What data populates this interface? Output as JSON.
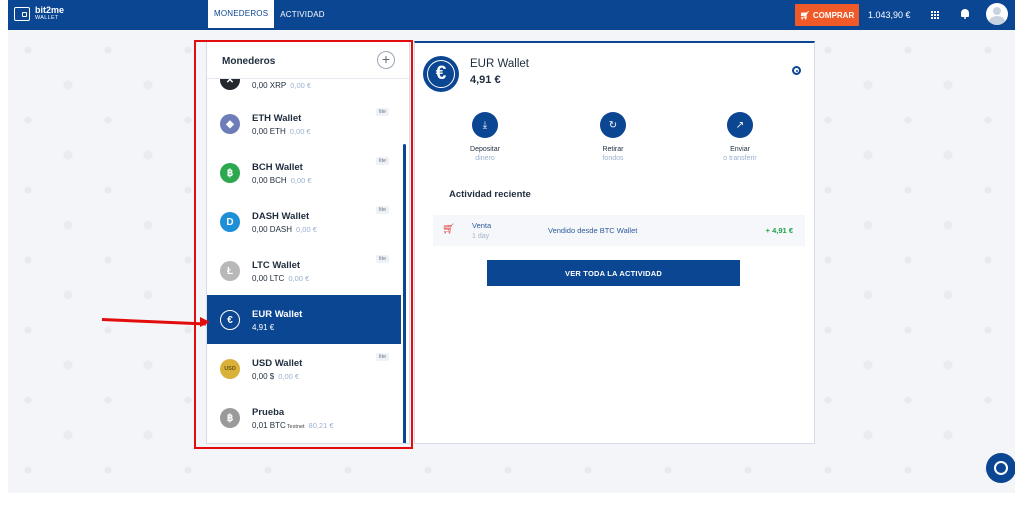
{
  "brand": {
    "name": "bit2me",
    "sub": "WALLET"
  },
  "nav": [
    {
      "label": "MONEDEROS",
      "active": true
    },
    {
      "label": "ACTIVIDAD",
      "active": false
    }
  ],
  "topbar": {
    "buy_label": "COMPRAR",
    "balance": "1.043,90 €"
  },
  "wallets_panel": {
    "title": "Monederos",
    "add_label": "+",
    "items": [
      {
        "name": "",
        "amount": "0,00 XRP",
        "fiat": "0,00 €",
        "tag": "",
        "icon": "xrp-icon",
        "color": "#23292f",
        "lite": false,
        "selected": false
      },
      {
        "name": "ETH Wallet",
        "amount": "0,00 ETH",
        "fiat": "0,00 €",
        "tag": "",
        "icon": "eth-icon",
        "color": "#6f7cba",
        "lite": true,
        "selected": false
      },
      {
        "name": "BCH Wallet",
        "amount": "0,00 BCH",
        "fiat": "0,00 €",
        "tag": "",
        "icon": "bch-icon",
        "color": "#2ca84f",
        "lite": true,
        "selected": false
      },
      {
        "name": "DASH Wallet",
        "amount": "0,00 DASH",
        "fiat": "0,00 €",
        "tag": "",
        "icon": "dash-icon",
        "color": "#1c8fd6",
        "lite": true,
        "selected": false
      },
      {
        "name": "LTC Wallet",
        "amount": "0,00 LTC",
        "fiat": "0,00 €",
        "tag": "",
        "icon": "ltc-icon",
        "color": "#b8b8b8",
        "lite": true,
        "selected": false
      },
      {
        "name": "EUR Wallet",
        "amount": "4,91 €",
        "fiat": "",
        "tag": "",
        "icon": "eur-icon",
        "color": "#0b4693",
        "lite": false,
        "selected": true
      },
      {
        "name": "USD Wallet",
        "amount": "0,00 $",
        "fiat": "0,00 €",
        "tag": "",
        "icon": "usd-icon",
        "color": "#d9b13a",
        "lite": true,
        "selected": false
      },
      {
        "name": "Prueba",
        "amount": "0,01 BTC",
        "fiat": "80,21 €",
        "tag": "Testnet",
        "icon": "btc-icon",
        "color": "#9a9a9a",
        "lite": false,
        "selected": false
      }
    ],
    "lite_label": "lite"
  },
  "detail": {
    "title": "EUR Wallet",
    "balance": "4,91 €",
    "actions": [
      {
        "label": "Depositar",
        "sub": "dinero",
        "icon": "deposit-icon"
      },
      {
        "label": "Retirar",
        "sub": "fondos",
        "icon": "withdraw-icon"
      },
      {
        "label": "Enviar",
        "sub": "o transferir",
        "icon": "send-icon"
      }
    ],
    "activity_title": "Actividad reciente",
    "activity": [
      {
        "type": "Venta",
        "time": "1 day",
        "description": "Vendido desde BTC Wallet",
        "amount": "+ 4,91 €"
      }
    ],
    "view_all_label": "VER TODA LA ACTIVIDAD"
  },
  "colors": {
    "primary": "#0b4693",
    "buy": "#f05a28",
    "highlight": "#e30c0c",
    "positive": "#1fa34a"
  }
}
